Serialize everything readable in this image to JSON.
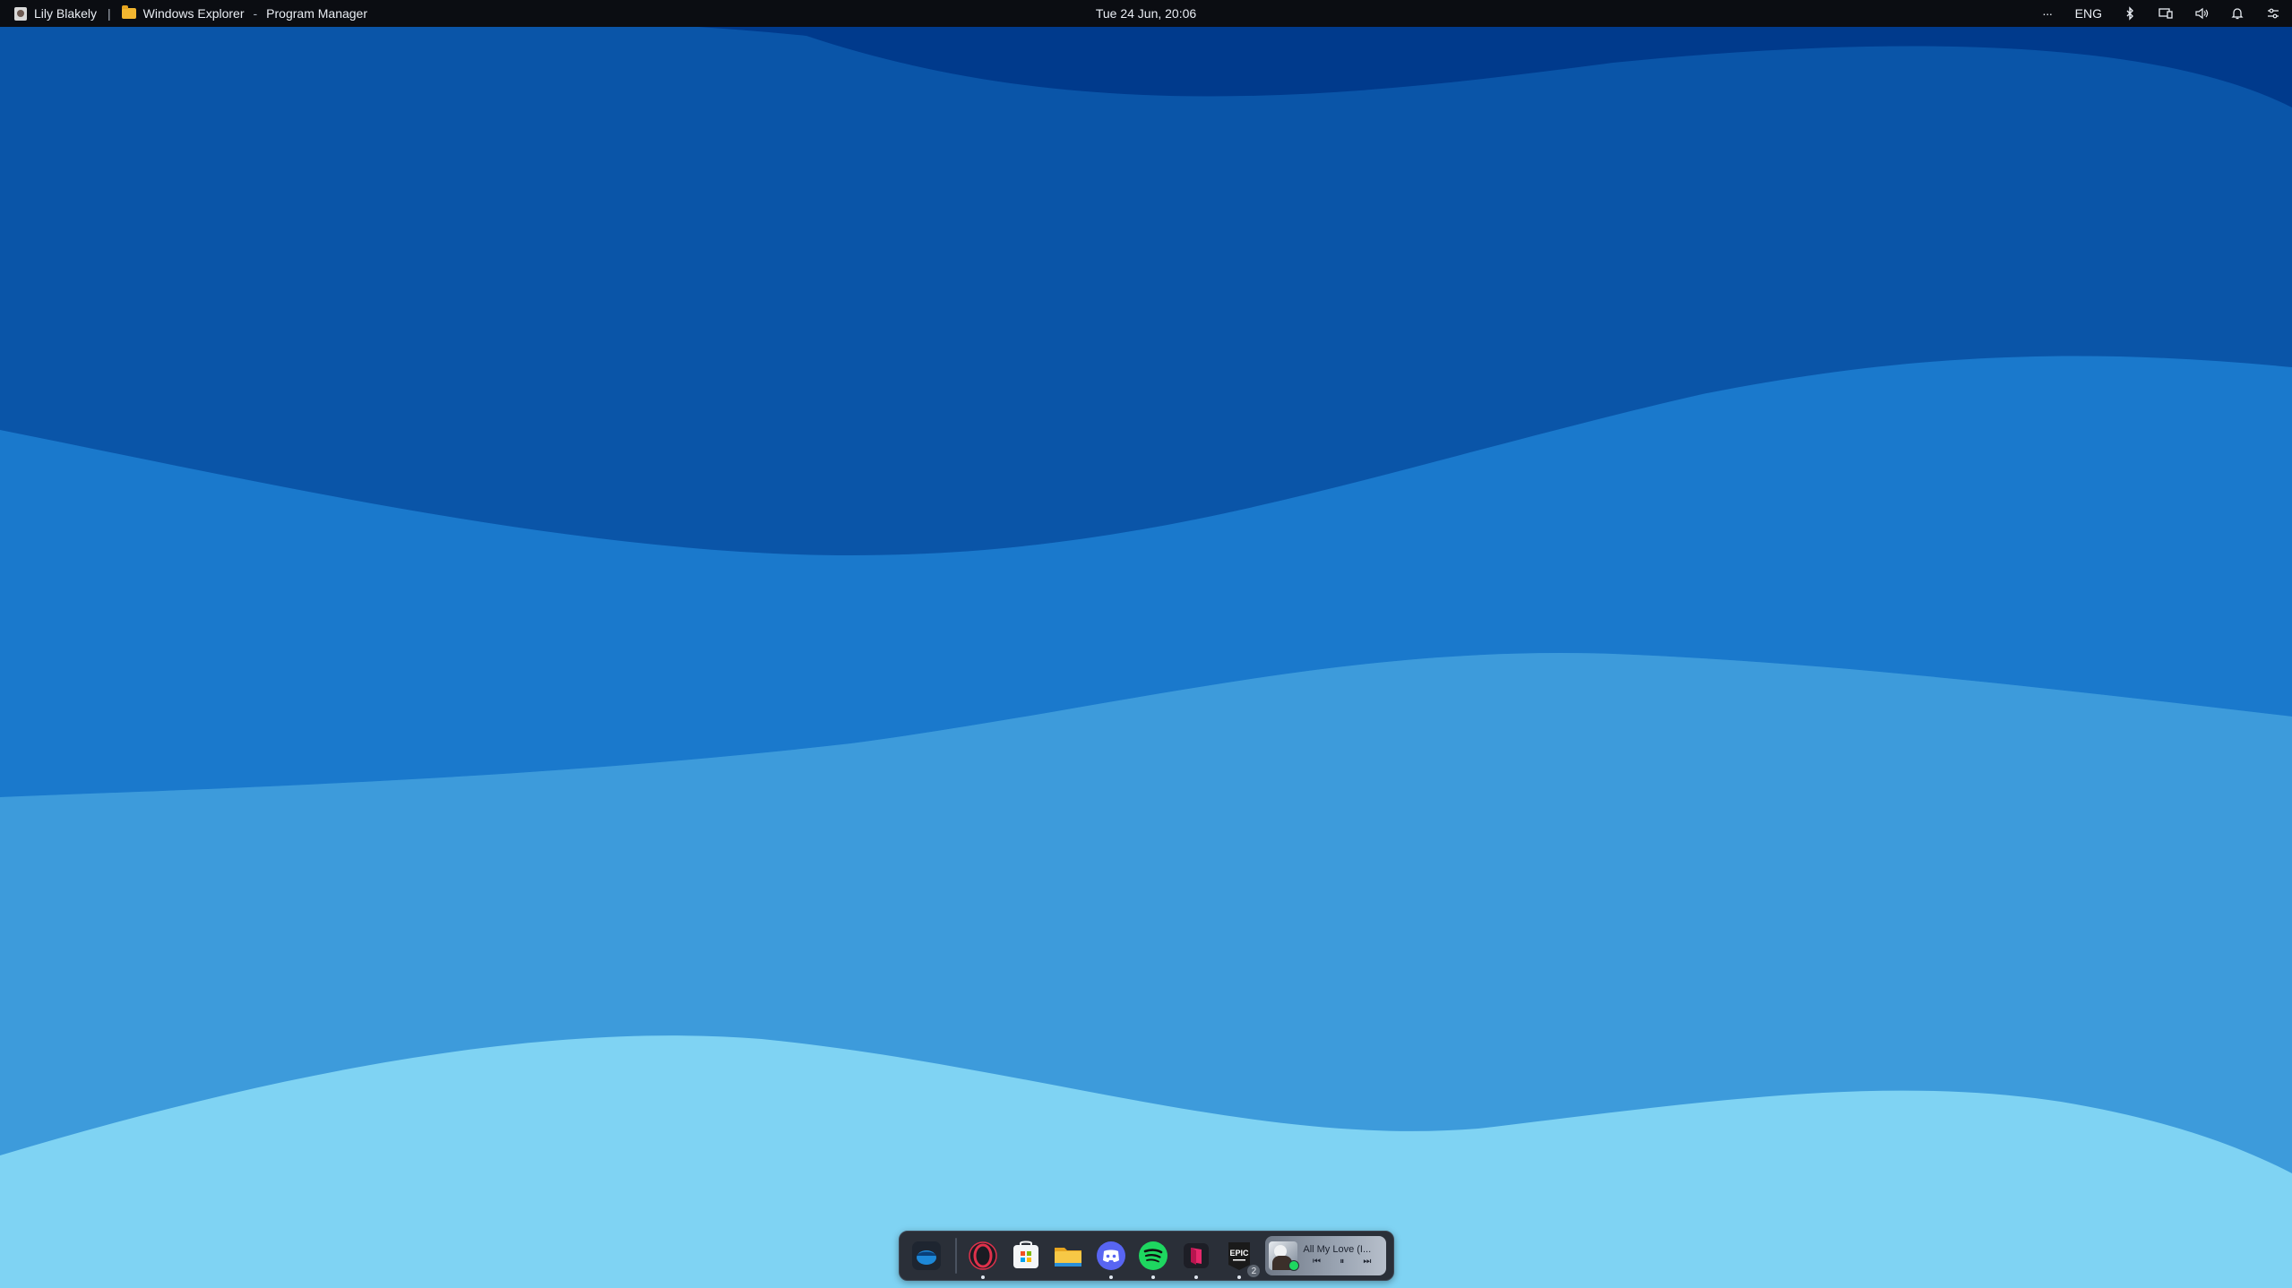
{
  "topbar": {
    "user_name": "Lily Blakely",
    "separator": "|",
    "window_app": "Windows Explorer",
    "window_dash": "-",
    "window_title": "Program Manager",
    "datetime": "Tue 24 Jun, 20:06",
    "overflow_label": "···",
    "language": "ENG"
  },
  "tray_icons": [
    "more-icon",
    "language-indicator",
    "bluetooth-icon",
    "display-icon",
    "volume-icon",
    "notification-bell-icon",
    "quick-settings-icon"
  ],
  "dock": {
    "apps": [
      {
        "name": "start-launcher",
        "running": false
      },
      {
        "name": "opera-gx",
        "running": true
      },
      {
        "name": "microsoft-store",
        "running": false
      },
      {
        "name": "file-explorer",
        "running": false
      },
      {
        "name": "discord",
        "running": true
      },
      {
        "name": "spotify",
        "running": true
      },
      {
        "name": "app-pink-icon",
        "running": true
      },
      {
        "name": "epic-games",
        "running": true,
        "badge": "2"
      }
    ],
    "epic_label": "EPIC",
    "epic_badge": "2",
    "media": {
      "title": "All My Love (I...",
      "prev_glyph": "⏮",
      "pause_glyph": "⏸",
      "next_glyph": "⏭"
    }
  },
  "colors": {
    "topbar_bg": "#0b0d12",
    "wave1": "#003a8c",
    "wave2": "#0a55a8",
    "wave3": "#1a79cc",
    "wave4": "#2d8fd8",
    "wave5": "#4aa6de",
    "wave6": "#7fd3f3"
  }
}
